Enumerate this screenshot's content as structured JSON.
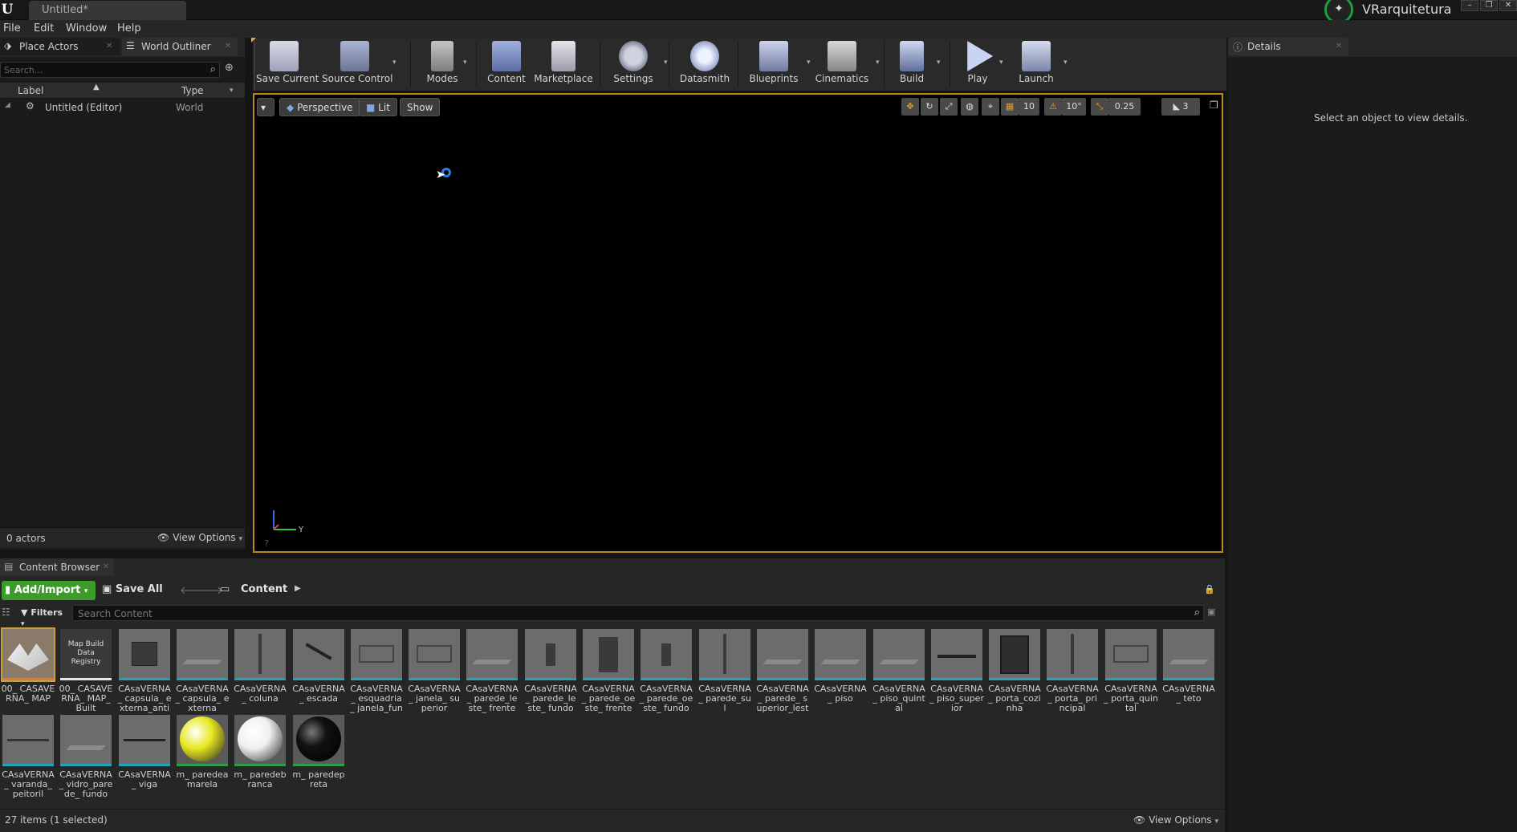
{
  "window": {
    "tab_title": "Untitled*",
    "project_name": "VRarquitetura",
    "controls": [
      "–",
      "❐",
      "✕"
    ]
  },
  "menu": [
    "File",
    "Edit",
    "Window",
    "Help"
  ],
  "left_panel": {
    "tabs": [
      "Place Actors",
      "World Outliner"
    ],
    "search_placeholder": "Search...",
    "columns": {
      "label": "Label",
      "type": "Type"
    },
    "rows": [
      {
        "label": "Untitled (Editor)",
        "type": "World"
      }
    ],
    "footer_count": "0 actors",
    "view_options": "View Options"
  },
  "toolbar": [
    {
      "label": "Save Current",
      "icon": "floppy-icon",
      "dropdown": false
    },
    {
      "label": "Source Control",
      "icon": "source-control-icon",
      "dropdown": true
    },
    {
      "label": "Modes",
      "icon": "modes-icon",
      "dropdown": true
    },
    {
      "label": "Content",
      "icon": "content-icon",
      "dropdown": false
    },
    {
      "label": "Marketplace",
      "icon": "marketplace-icon",
      "dropdown": false
    },
    {
      "label": "Settings",
      "icon": "settings-icon",
      "dropdown": true
    },
    {
      "label": "Datasmith",
      "icon": "datasmith-icon",
      "dropdown": false
    },
    {
      "label": "Blueprints",
      "icon": "blueprints-icon",
      "dropdown": true
    },
    {
      "label": "Cinematics",
      "icon": "cinematics-icon",
      "dropdown": true
    },
    {
      "label": "Build",
      "icon": "build-icon",
      "dropdown": true
    },
    {
      "label": "Play",
      "icon": "play-icon",
      "dropdown": true
    },
    {
      "label": "Launch",
      "icon": "launch-icon",
      "dropdown": true
    }
  ],
  "viewport": {
    "perspective": "Perspective",
    "lit": "Lit",
    "show": "Show",
    "grid_snap": "10",
    "rotation_snap": "10°",
    "scale_snap": "0.25",
    "camera_speed": "3",
    "axis_y": "Y"
  },
  "details": {
    "tab": "Details",
    "empty_message": "Select an object to view details."
  },
  "content_browser": {
    "tab": "Content Browser",
    "add_import": "Add/Import",
    "save_all": "Save All",
    "path": "Content",
    "filters": "Filters",
    "search_placeholder": "Search Content",
    "status": "27 items (1 selected)",
    "view_options": "View Options",
    "assets": [
      {
        "name": "00_ CASAVERNA_ MAP",
        "kind": "map"
      },
      {
        "name": "00_ CASAVERNA_ MAP_Built",
        "kind": "registry",
        "thumb_text": "Map Build Data Registry"
      },
      {
        "name": "CAsaVERNA_ capsula_ externa_anti",
        "kind": "mesh-box"
      },
      {
        "name": "CAsaVERNA_ capsula_ externa",
        "kind": "mesh-flat"
      },
      {
        "name": "CAsaVERNA_ coluna",
        "kind": "mesh-pole"
      },
      {
        "name": "CAsaVERNA_ escada",
        "kind": "mesh-stairs"
      },
      {
        "name": "CAsaVERNA_ esquadria_ janela_fundo",
        "kind": "mesh-frame"
      },
      {
        "name": "CAsaVERNA_ janela_ superior",
        "kind": "mesh-frame"
      },
      {
        "name": "CAsaVERNA_ parede_leste_ frente",
        "kind": "mesh-flat"
      },
      {
        "name": "CAsaVERNA_ parede_leste_ fundo",
        "kind": "mesh-wall-small"
      },
      {
        "name": "CAsaVERNA_ parede_oeste_ frente",
        "kind": "mesh-wall"
      },
      {
        "name": "CAsaVERNA_ parede_oeste_ fundo",
        "kind": "mesh-wall-small"
      },
      {
        "name": "CAsaVERNA_ parede_sul",
        "kind": "mesh-pole"
      },
      {
        "name": "CAsaVERNA_ parede_ superior_leste",
        "kind": "mesh-flat"
      },
      {
        "name": "CAsaVERNA_ piso",
        "kind": "mesh-flat"
      },
      {
        "name": "CAsaVERNA_ piso_quintal",
        "kind": "mesh-flat"
      },
      {
        "name": "CAsaVERNA_ piso_superior",
        "kind": "mesh-slab"
      },
      {
        "name": "CAsaVERNA_ porta_cozinha",
        "kind": "mesh-door"
      },
      {
        "name": "CAsaVERNA_ porta_ principal",
        "kind": "mesh-pole"
      },
      {
        "name": "CAsaVERNA_ porta_quintal",
        "kind": "mesh-frame"
      },
      {
        "name": "CAsaVERNA_ teto",
        "kind": "mesh-flat"
      },
      {
        "name": "CAsaVERNA_ varanda_ peitoril",
        "kind": "mesh-rail"
      },
      {
        "name": "CAsaVERNA_ vidro_parede_ fundo",
        "kind": "mesh-flat"
      },
      {
        "name": "CAsaVERNA_ viga",
        "kind": "mesh-beam"
      },
      {
        "name": "m_ paredeamarela",
        "kind": "mat",
        "color": "#e8e820"
      },
      {
        "name": "m_ paredebranca",
        "kind": "mat",
        "color": "#f0f0f0"
      },
      {
        "name": "m_ paredepreta",
        "kind": "mat",
        "color": "#111111"
      }
    ]
  },
  "colors": {
    "accent_green": "#3c9b2a",
    "viewport_border": "#b88a1d",
    "mesh_underline": "#1fa4b8"
  }
}
